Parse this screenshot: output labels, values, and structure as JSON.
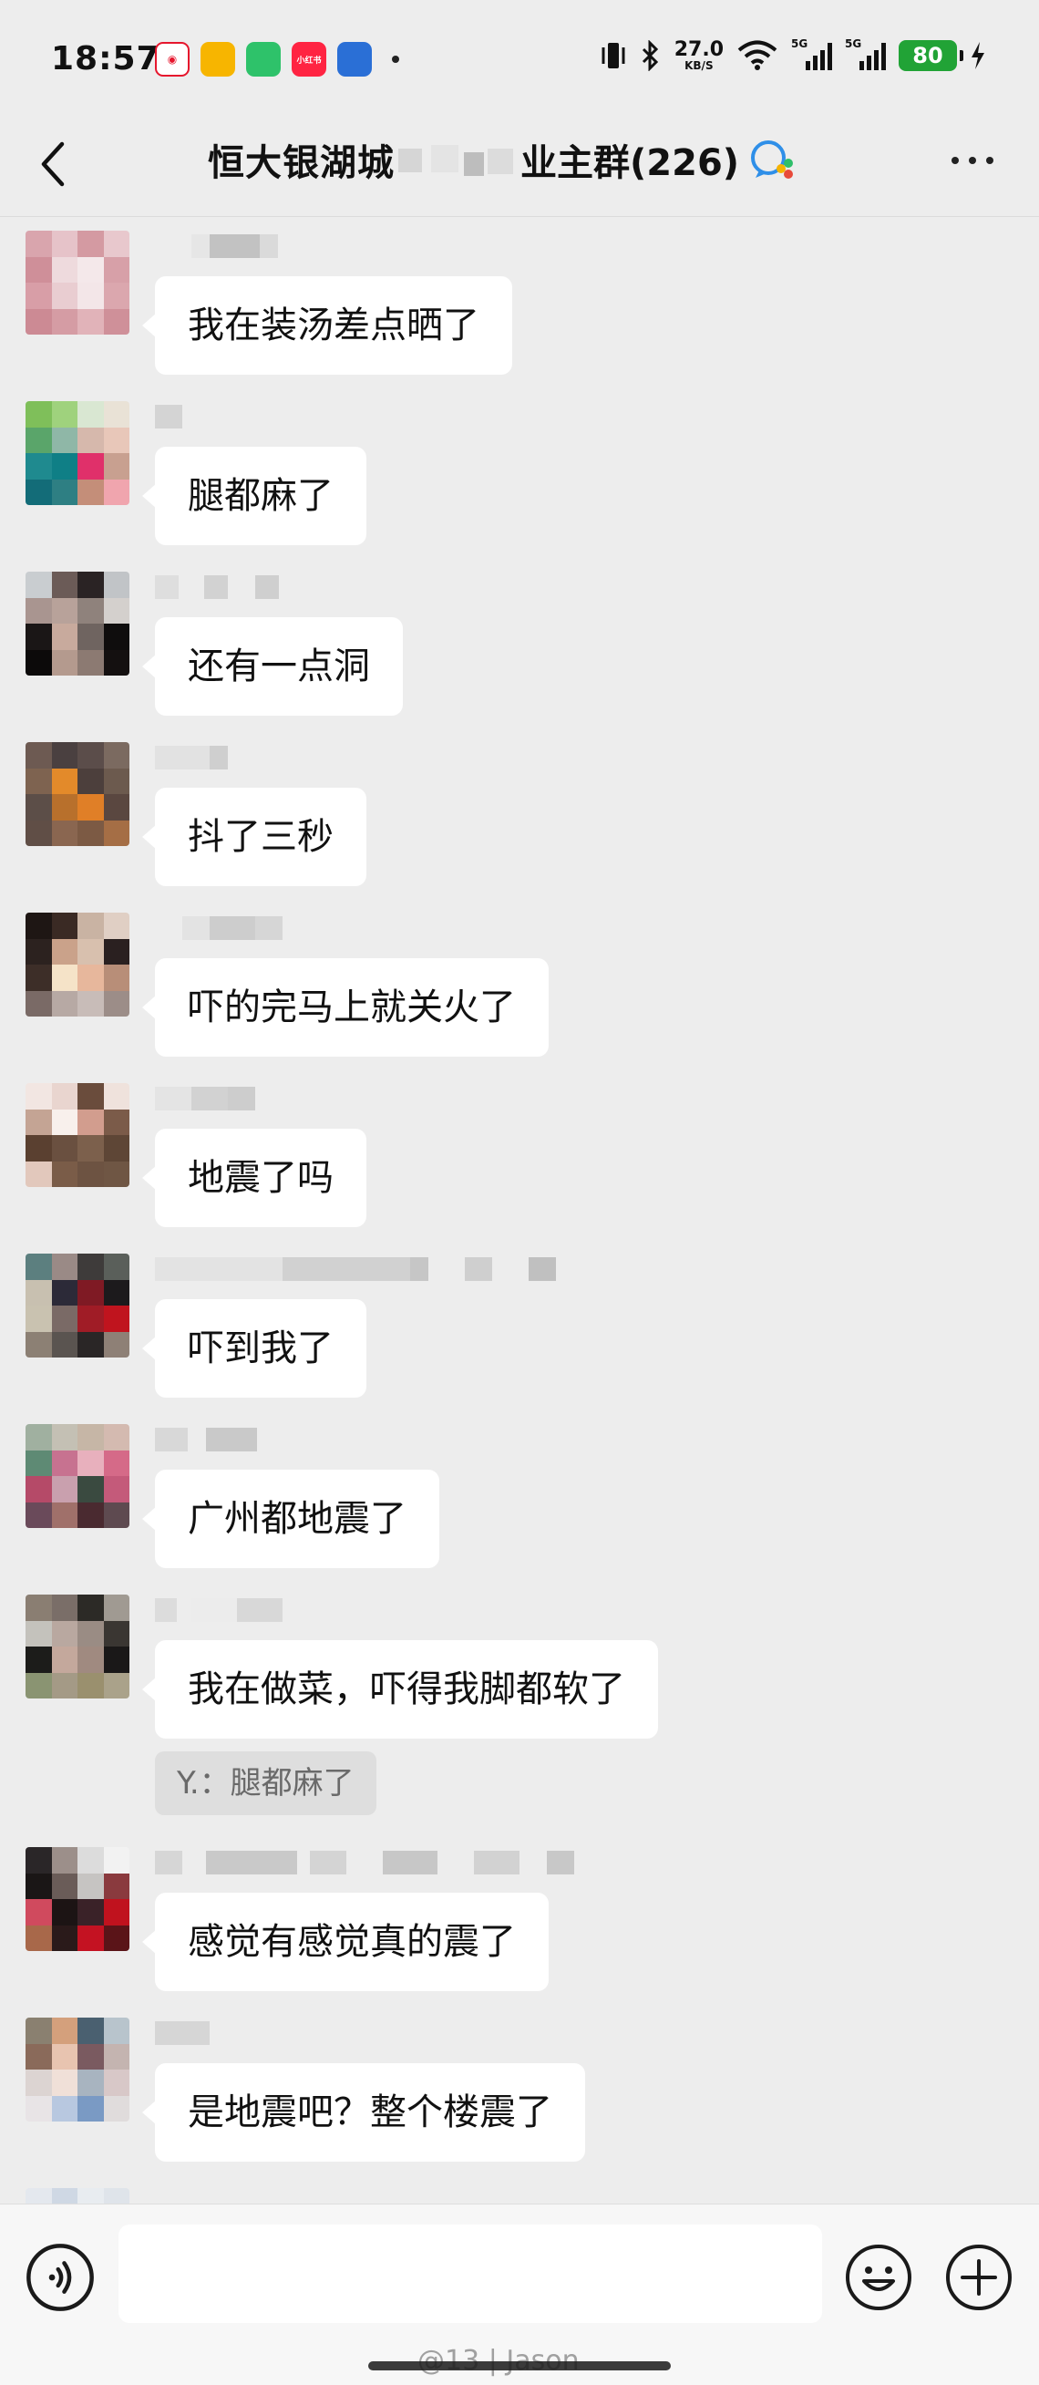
{
  "status_bar": {
    "time": "18:57",
    "app_icons": [
      {
        "name": "weibo-icon",
        "color": "#ffffff",
        "fg": "#e6162d",
        "label": ""
      },
      {
        "name": "mail-icon",
        "color": "#f7b500",
        "fg": "#ffffff",
        "label": ""
      },
      {
        "name": "wallet-icon",
        "color": "#2ec26a",
        "fg": "#ffffff",
        "label": ""
      },
      {
        "name": "xiaohongshu-icon",
        "color": "#ff2442",
        "fg": "#ffffff",
        "label": "小红书"
      },
      {
        "name": "bilibili-icon",
        "color": "#2a6fd6",
        "fg": "#ffffff",
        "label": ""
      }
    ],
    "net_speed_value": "27.0",
    "net_speed_unit": "KB/S",
    "signal1_label": "5G",
    "signal1_sub": "R",
    "signal2_label": "5G",
    "battery": "80"
  },
  "nav": {
    "title_part1": "恒大银湖城",
    "title_part2": "业主群(226)"
  },
  "messages": [
    {
      "text": "我在装汤差点晒了",
      "avatar": [
        "#d9a5ad",
        "#e6c3c9",
        "#d49aa2",
        "#e8c8cd",
        "#cf8f99",
        "#eedadd",
        "#f4e8ea",
        "#d7a0a8",
        "#d89ea7",
        "#e9cdd1",
        "#f3e6e8",
        "#dba7ae",
        "#cc8a94",
        "#d59ca4",
        "#e1b3b9",
        "#cf9099"
      ],
      "nick": [
        [
          40,
          20,
          "#e6e6e6"
        ],
        [
          60,
          55,
          "#c2c2c2"
        ],
        [
          115,
          20,
          "#dadada"
        ]
      ]
    },
    {
      "text": "腿都麻了",
      "avatar": [
        "#7fbf5a",
        "#9fd27d",
        "#d9e7d2",
        "#e9e2d6",
        "#5aa56a",
        "#8fb7a7",
        "#d6b8ac",
        "#e8c7b9",
        "#1f8a8f",
        "#0f7f86",
        "#e0306a",
        "#c8a090",
        "#136c78",
        "#2e7f83",
        "#c48e79",
        "#f0a5ae"
      ],
      "nick": [
        [
          0,
          30,
          "#d4d4d4"
        ]
      ]
    },
    {
      "text": "还有一点洞",
      "avatar": [
        "#c9cdd0",
        "#6b5b57",
        "#2a2324",
        "#c1c4c7",
        "#a99590",
        "#b8a29a",
        "#8f827c",
        "#d4d0cd",
        "#1a1616",
        "#c8aa9d",
        "#6f6460",
        "#0f0d0d",
        "#0c0a0a",
        "#b49a8e",
        "#8c7a72",
        "#141010"
      ],
      "nick": [
        [
          0,
          26,
          "#dedede"
        ],
        [
          54,
          26,
          "#d2d2d2"
        ],
        [
          110,
          26,
          "#cfcfcf"
        ]
      ]
    },
    {
      "text": "抖了三秒",
      "avatar": [
        "#6d5a52",
        "#4a4040",
        "#5b4d4a",
        "#7b6a60",
        "#7e6350",
        "#e38a2a",
        "#4c3f3c",
        "#6c5a4e",
        "#5c4e48",
        "#b8702c",
        "#e07f27",
        "#5a4740",
        "#604e46",
        "#8a6650",
        "#7c5a44",
        "#a56e45"
      ],
      "nick": [
        [
          0,
          60,
          "#e2e2e2"
        ],
        [
          60,
          20,
          "#cfcfcf"
        ]
      ]
    },
    {
      "text": "吓的完马上就关火了",
      "avatar": [
        "#1e1614",
        "#3a2a24",
        "#c9b3a3",
        "#e0cfc4",
        "#2c221f",
        "#caa28a",
        "#d8c0ae",
        "#2a2020",
        "#3d2e28",
        "#f5e3c8",
        "#e7b79c",
        "#b88e78",
        "#7a6a66",
        "#b7a9a4",
        "#c8bcb8",
        "#9c8d88"
      ],
      "nick": [
        [
          30,
          30,
          "#e3e3e3"
        ],
        [
          60,
          50,
          "#cdcdcd"
        ],
        [
          110,
          30,
          "#d6d6d6"
        ]
      ]
    },
    {
      "text": "地震了吗",
      "avatar": [
        "#f2e6e2",
        "#e9d5cf",
        "#6a4c3c",
        "#efe2dc",
        "#c4a494",
        "#f8f0ec",
        "#d29d8e",
        "#7b5b49",
        "#5a4030",
        "#6a5040",
        "#7c604c",
        "#5e4636",
        "#e2c8bc",
        "#7a5c48",
        "#6d5342",
        "#6f5644"
      ],
      "nick": [
        [
          0,
          40,
          "#e4e4e4"
        ],
        [
          40,
          40,
          "#d2d2d2"
        ],
        [
          80,
          30,
          "#cdcdcd"
        ]
      ]
    },
    {
      "text": "吓到我了",
      "avatar": [
        "#5c7f7f",
        "#9a8a86",
        "#3e3b3a",
        "#5a5f5a",
        "#c8c0b0",
        "#2c2a38",
        "#7f1a24",
        "#1c1a1c",
        "#c9c2b0",
        "#7a6a66",
        "#a01c26",
        "#c0141e",
        "#8c8074",
        "#5a5450",
        "#2a2626",
        "#8e8076"
      ],
      "nick": [
        [
          0,
          140,
          "#e3e3e3"
        ],
        [
          140,
          140,
          "#d1d1d1"
        ],
        [
          280,
          20,
          "#c6c6c6"
        ],
        [
          340,
          30,
          "#cfcfcf"
        ],
        [
          410,
          30,
          "#c0c0c0"
        ]
      ]
    },
    {
      "text": "广州都地震了",
      "avatar": [
        "#a0b0a0",
        "#c4c0b4",
        "#c6b6a6",
        "#d4bab0",
        "#5e8a74",
        "#c77290",
        "#e8b0bd",
        "#d56a88",
        "#b54a68",
        "#c9a0ae",
        "#3a4a40",
        "#c45a7a",
        "#6a4a5a",
        "#a0706a",
        "#4a2a30",
        "#5e4a50"
      ],
      "nick": [
        [
          0,
          36,
          "#d8d8d8"
        ],
        [
          56,
          56,
          "#c9c9c9"
        ]
      ]
    },
    {
      "text": "我在做菜，吓得我脚都软了",
      "avatar": [
        "#8a7e72",
        "#7a6e68",
        "#2c2a26",
        "#a09a92",
        "#c4c2bc",
        "#b9a8a0",
        "#9a8c84",
        "#3a3632",
        "#1c1c1a",
        "#c4a89c",
        "#a08a80",
        "#1a1818",
        "#8a9472",
        "#a49a86",
        "#9a906e",
        "#aaa28a"
      ],
      "nick": [
        [
          0,
          24,
          "#dcdcdc"
        ],
        [
          40,
          50,
          "#ececec"
        ],
        [
          90,
          50,
          "#d8d8d8"
        ]
      ],
      "quote": "Y.：腿都麻了"
    },
    {
      "text": "感觉有感觉真的震了",
      "avatar": [
        "#2a2628",
        "#9c8f8a",
        "#dcdcdc",
        "#f2f2f2",
        "#1a1616",
        "#6a5c58",
        "#c6c4c2",
        "#8a3a3e",
        "#d04a5e",
        "#1c1414",
        "#3a2228",
        "#c0121e",
        "#a8684a",
        "#2a1a1a",
        "#c41222",
        "#5a1418"
      ],
      "nick": [
        [
          0,
          30,
          "#d6d6d6"
        ],
        [
          56,
          100,
          "#c9c9c9"
        ],
        [
          170,
          40,
          "#d4d4d4"
        ],
        [
          250,
          60,
          "#c7c7c7"
        ],
        [
          350,
          50,
          "#d2d2d2"
        ],
        [
          430,
          30,
          "#c8c8c8"
        ]
      ]
    },
    {
      "text": "是地震吧？整个楼震了",
      "avatar": [
        "#8a8070",
        "#d4a07c",
        "#4a6070",
        "#b8c4cc",
        "#8a6a5a",
        "#e8c4b0",
        "#7a5a60",
        "#c4b4b0",
        "#dcd4d2",
        "#f0e0d8",
        "#a8b4c0",
        "#d8c8c8",
        "#e8e4e6",
        "#b8c8e0",
        "#7a9ac4",
        "#e0dcdc"
      ],
      "nick": [
        [
          0,
          60,
          "#d6d6d6"
        ]
      ]
    }
  ],
  "input_bar": {
    "watermark": "@13 | Jason"
  }
}
